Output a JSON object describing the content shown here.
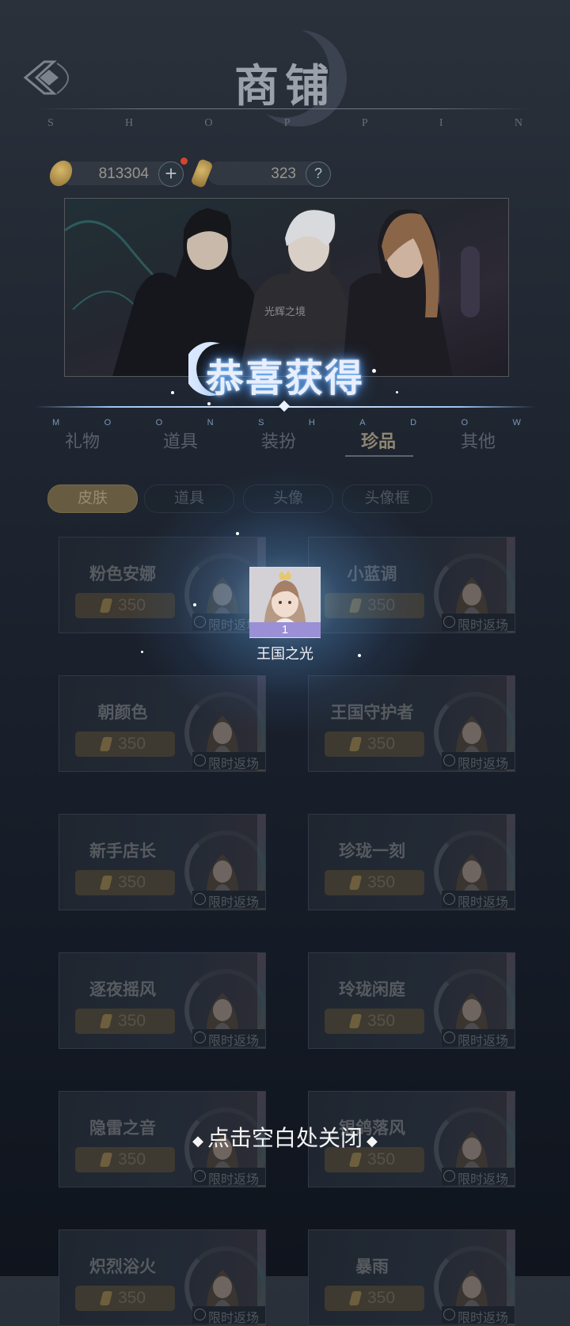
{
  "header": {
    "title": "商铺",
    "subtitle_letters": [
      "S",
      "H",
      "O",
      "P",
      "P",
      "I",
      "N"
    ]
  },
  "currency": {
    "gold": "813304",
    "gems": "323"
  },
  "banner": {
    "caption": "光辉之境"
  },
  "overlay": {
    "congrats": "恭喜获得",
    "moonshadow_letters": [
      "M",
      "O",
      "O",
      "N",
      "S",
      "H",
      "A",
      "D",
      "O",
      "W"
    ],
    "item": {
      "name": "王国之光",
      "count": "1"
    },
    "close_hint": "点击空白处关闭"
  },
  "tabs": [
    {
      "label": "礼物"
    },
    {
      "label": "道具"
    },
    {
      "label": "装扮"
    },
    {
      "label": "珍品",
      "active": true
    },
    {
      "label": "其他"
    }
  ],
  "subtabs": [
    {
      "label": "皮肤",
      "active": true
    },
    {
      "label": "道具"
    },
    {
      "label": "头像"
    },
    {
      "label": "头像框"
    }
  ],
  "cards": [
    {
      "name": "粉色安娜",
      "price": "350",
      "tag": "限时返场"
    },
    {
      "name": "小蓝调",
      "price": "350",
      "tag": "限时返场"
    },
    {
      "name": "朝颜色",
      "price": "350",
      "tag": "限时返场"
    },
    {
      "name": "王国守护者",
      "price": "350",
      "tag": "限时返场"
    },
    {
      "name": "新手店长",
      "price": "350",
      "tag": "限时返场"
    },
    {
      "name": "珍珑一刻",
      "price": "350",
      "tag": "限时返场"
    },
    {
      "name": "逐夜摇风",
      "price": "350",
      "tag": "限时返场"
    },
    {
      "name": "玲珑闲庭",
      "price": "350",
      "tag": "限时返场"
    },
    {
      "name": "隐雷之音",
      "price": "350",
      "tag": "限时返场"
    },
    {
      "name": "银鸽落风",
      "price": "350",
      "tag": "限时返场"
    },
    {
      "name": "炽烈浴火",
      "price": "350",
      "tag": "限时返场"
    },
    {
      "name": "暴雨",
      "price": "350",
      "tag": "限时返场"
    }
  ],
  "colors": {
    "accent_gold": "#675c41",
    "glow_blue": "#6fb5ff",
    "item_count_bg": "#9b8fd6"
  }
}
